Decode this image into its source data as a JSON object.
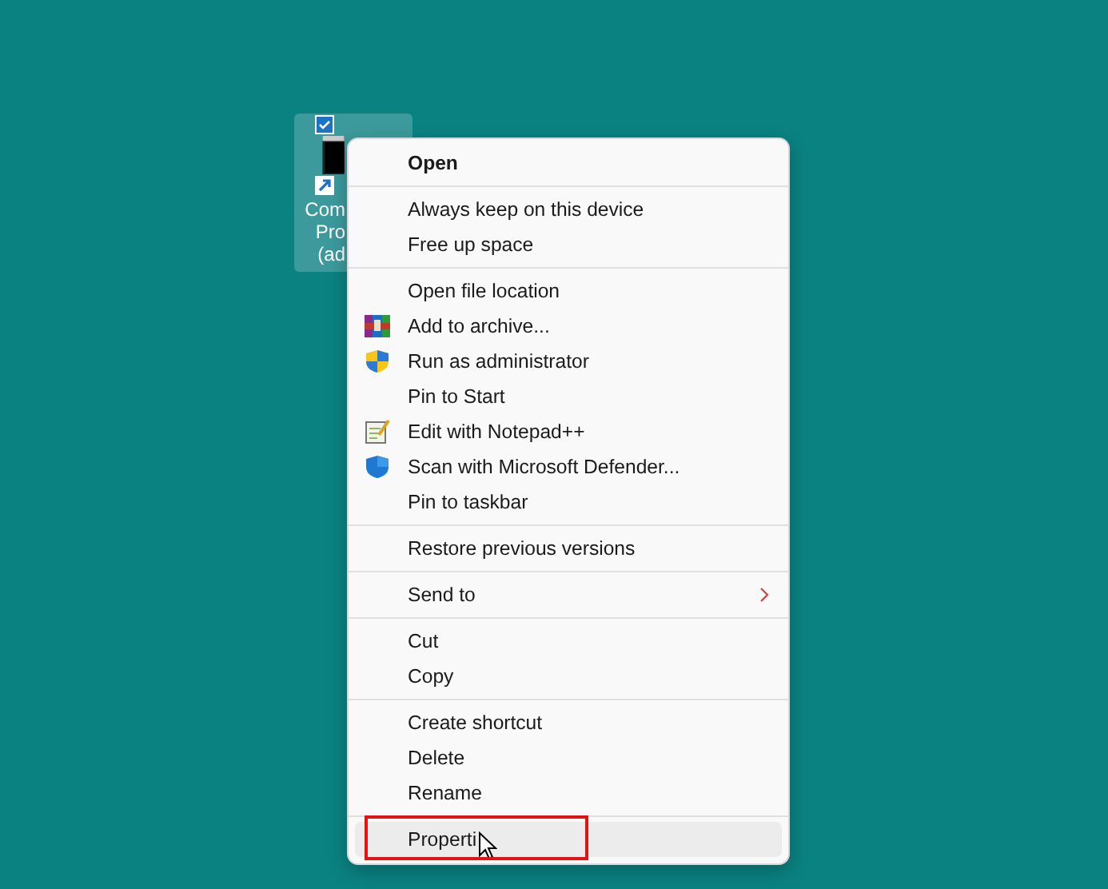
{
  "desktop_icon": {
    "label_lines": [
      "Com",
      "Pro",
      "(ad"
    ],
    "selected": true,
    "checked": true
  },
  "context_menu": {
    "groups": [
      [
        {
          "label": "Open",
          "bold": true,
          "kind": "plain",
          "selected": false
        }
      ],
      [
        {
          "label": "Always keep on this device",
          "bold": false,
          "kind": "plain",
          "selected": false
        },
        {
          "label": "Free up space",
          "bold": false,
          "kind": "plain",
          "selected": false
        }
      ],
      [
        {
          "label": "Open file location",
          "bold": false,
          "kind": "plain",
          "selected": false
        },
        {
          "label": "Add to archive...",
          "bold": false,
          "kind": "archive",
          "selected": false
        },
        {
          "label": "Run as administrator",
          "bold": false,
          "kind": "admin",
          "selected": false
        },
        {
          "label": "Pin to Start",
          "bold": false,
          "kind": "plain",
          "selected": false
        },
        {
          "label": "Edit with Notepad++",
          "bold": false,
          "kind": "editor",
          "selected": false
        },
        {
          "label": "Scan with Microsoft Defender...",
          "bold": false,
          "kind": "scan",
          "selected": false
        },
        {
          "label": "Pin to taskbar",
          "bold": false,
          "kind": "plain",
          "selected": false
        }
      ],
      [
        {
          "label": "Restore previous versions",
          "bold": false,
          "kind": "plain",
          "selected": false
        }
      ],
      [
        {
          "label": "Send to",
          "bold": false,
          "kind": "submenu",
          "selected": false
        }
      ],
      [
        {
          "label": "Cut",
          "bold": false,
          "kind": "plain",
          "selected": false
        },
        {
          "label": "Copy",
          "bold": false,
          "kind": "plain",
          "selected": false
        }
      ],
      [
        {
          "label": "Create shortcut",
          "bold": false,
          "kind": "plain",
          "selected": false
        },
        {
          "label": "Delete",
          "bold": false,
          "kind": "plain",
          "selected": false
        },
        {
          "label": "Rename",
          "bold": false,
          "kind": "plain",
          "selected": false
        }
      ],
      [
        {
          "label": "Properti",
          "bold": false,
          "kind": "plain",
          "selected": true
        }
      ]
    ]
  }
}
